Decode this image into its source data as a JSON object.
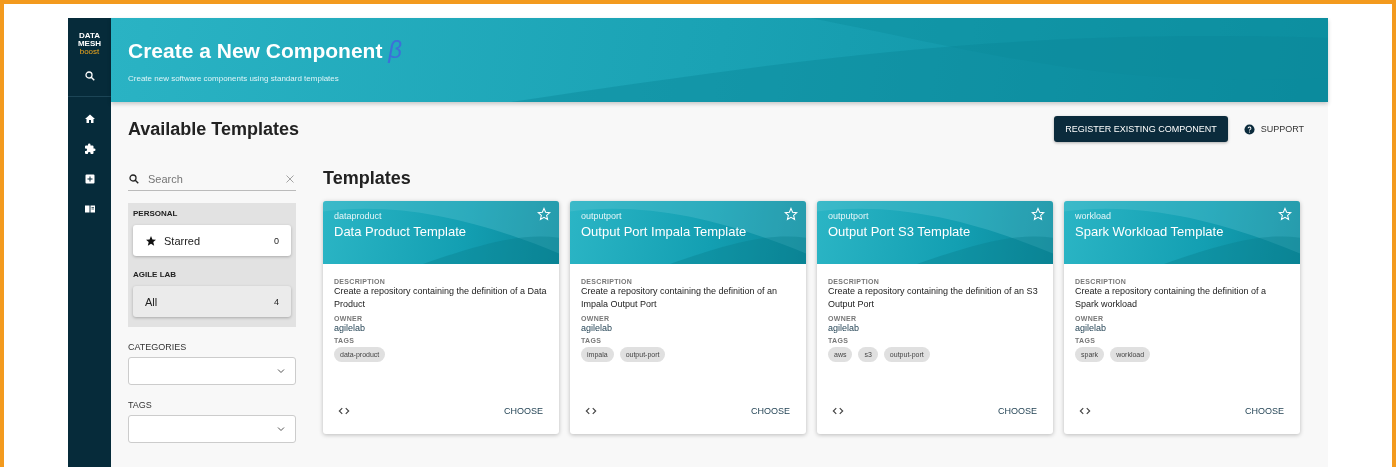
{
  "logo": {
    "line1": "DATA",
    "line2": "MESH",
    "line3": "boost"
  },
  "header": {
    "title": "Create a New Component",
    "beta": "β",
    "subtitle": "Create new software components using standard templates"
  },
  "page_title": "Available Templates",
  "actions": {
    "register": "REGISTER EXISTING COMPONENT",
    "support": "SUPPORT"
  },
  "search": {
    "placeholder": "Search"
  },
  "filter_groups": [
    {
      "title": "PERSONAL",
      "items": [
        {
          "label": "Starred",
          "count": "0",
          "kind": "starred",
          "selected": false
        }
      ]
    },
    {
      "title": "AGILE LAB",
      "items": [
        {
          "label": "All",
          "count": "4",
          "kind": "plain",
          "selected": true
        }
      ]
    }
  ],
  "dropdowns": [
    {
      "label": "CATEGORIES"
    },
    {
      "label": "TAGS"
    }
  ],
  "section_title": "Templates",
  "cards": [
    {
      "type": "dataproduct",
      "title": "Data Product Template",
      "description_label": "DESCRIPTION",
      "description": "Create a repository containing the definition of a Data Product",
      "owner_label": "OWNER",
      "owner": "agilelab",
      "tags_label": "TAGS",
      "tags": [
        "data-product"
      ],
      "choose": "CHOOSE",
      "starred": false
    },
    {
      "type": "outputport",
      "title": "Output Port Impala Template",
      "description_label": "DESCRIPTION",
      "description": "Create a repository containing the definition of an Impala Output Port",
      "owner_label": "OWNER",
      "owner": "agilelab",
      "tags_label": "TAGS",
      "tags": [
        "impala",
        "output-port"
      ],
      "choose": "CHOOSE",
      "starred": false
    },
    {
      "type": "outputport",
      "title": "Output Port S3 Template",
      "description_label": "DESCRIPTION",
      "description": "Create a repository containing the definition of an S3 Output Port",
      "owner_label": "OWNER",
      "owner": "agilelab",
      "tags_label": "TAGS",
      "tags": [
        "aws",
        "s3",
        "output-port"
      ],
      "choose": "CHOOSE",
      "starred": false
    },
    {
      "type": "workload",
      "title": "Spark Workload Template",
      "description_label": "DESCRIPTION",
      "description": "Create a repository containing the definition of a Spark workload",
      "owner_label": "OWNER",
      "owner": "agilelab",
      "tags_label": "TAGS",
      "tags": [
        "spark",
        "workload"
      ],
      "choose": "CHOOSE",
      "starred": false
    }
  ]
}
